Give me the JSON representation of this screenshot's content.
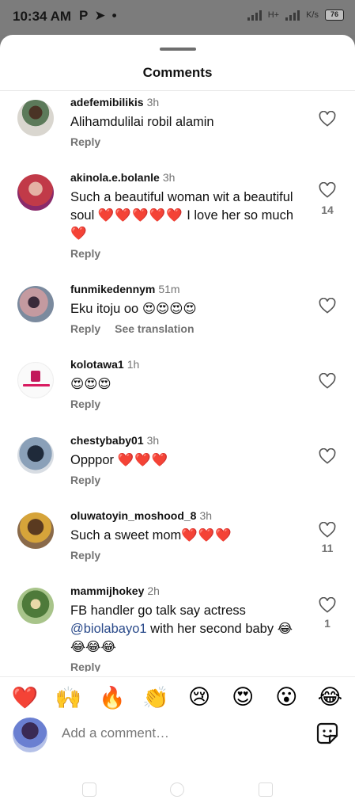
{
  "status_bar": {
    "time": "10:34 AM",
    "icons": [
      "parking-icon",
      "telegram-icon",
      "dot"
    ],
    "battery": "76",
    "network": "H+"
  },
  "sheet": {
    "title": "Comments"
  },
  "comments": [
    {
      "username": "adefemibilikis",
      "time": "3h",
      "text": "Alihamdulilai robil alamin",
      "reply": "Reply",
      "likes": ""
    },
    {
      "username": "akinola.e.bolanle",
      "time": "3h",
      "text": "Such a beautiful woman wit a beautiful soul",
      "emoji": "❤️❤️❤️❤️❤️",
      "text2": "I love her so much",
      "emoji2": "❤️",
      "reply": "Reply",
      "likes": "14"
    },
    {
      "username": "funmikedennym",
      "time": "51m",
      "text": "Eku itoju oo",
      "emoji": "😍😍😍😍",
      "reply": "Reply",
      "translate": "See translation",
      "likes": ""
    },
    {
      "username": "kolotawa1",
      "time": "1h",
      "text": "",
      "emoji": "😍😍😍",
      "reply": "Reply",
      "likes": ""
    },
    {
      "username": "chestybaby01",
      "time": "3h",
      "text": "Opppor",
      "emoji": "❤️❤️❤️",
      "reply": "Reply",
      "likes": ""
    },
    {
      "username": "oluwatoyin_moshood_8",
      "time": "3h",
      "text": "Such a sweet mom",
      "emoji": "❤️❤️❤️",
      "reply": "Reply",
      "likes": "11"
    },
    {
      "username": "mammijhokey",
      "time": "2h",
      "text": "FB handler go talk say actress",
      "mention": "@biolabayo1",
      "text2": "with her second baby",
      "emoji": "😂😂😂😂",
      "reply": "Reply",
      "likes": "1"
    }
  ],
  "reactions": [
    "❤️",
    "🙌",
    "🔥",
    "👏",
    "😢",
    "😍",
    "😮",
    "😂"
  ],
  "compose": {
    "placeholder": "Add a comment…"
  }
}
